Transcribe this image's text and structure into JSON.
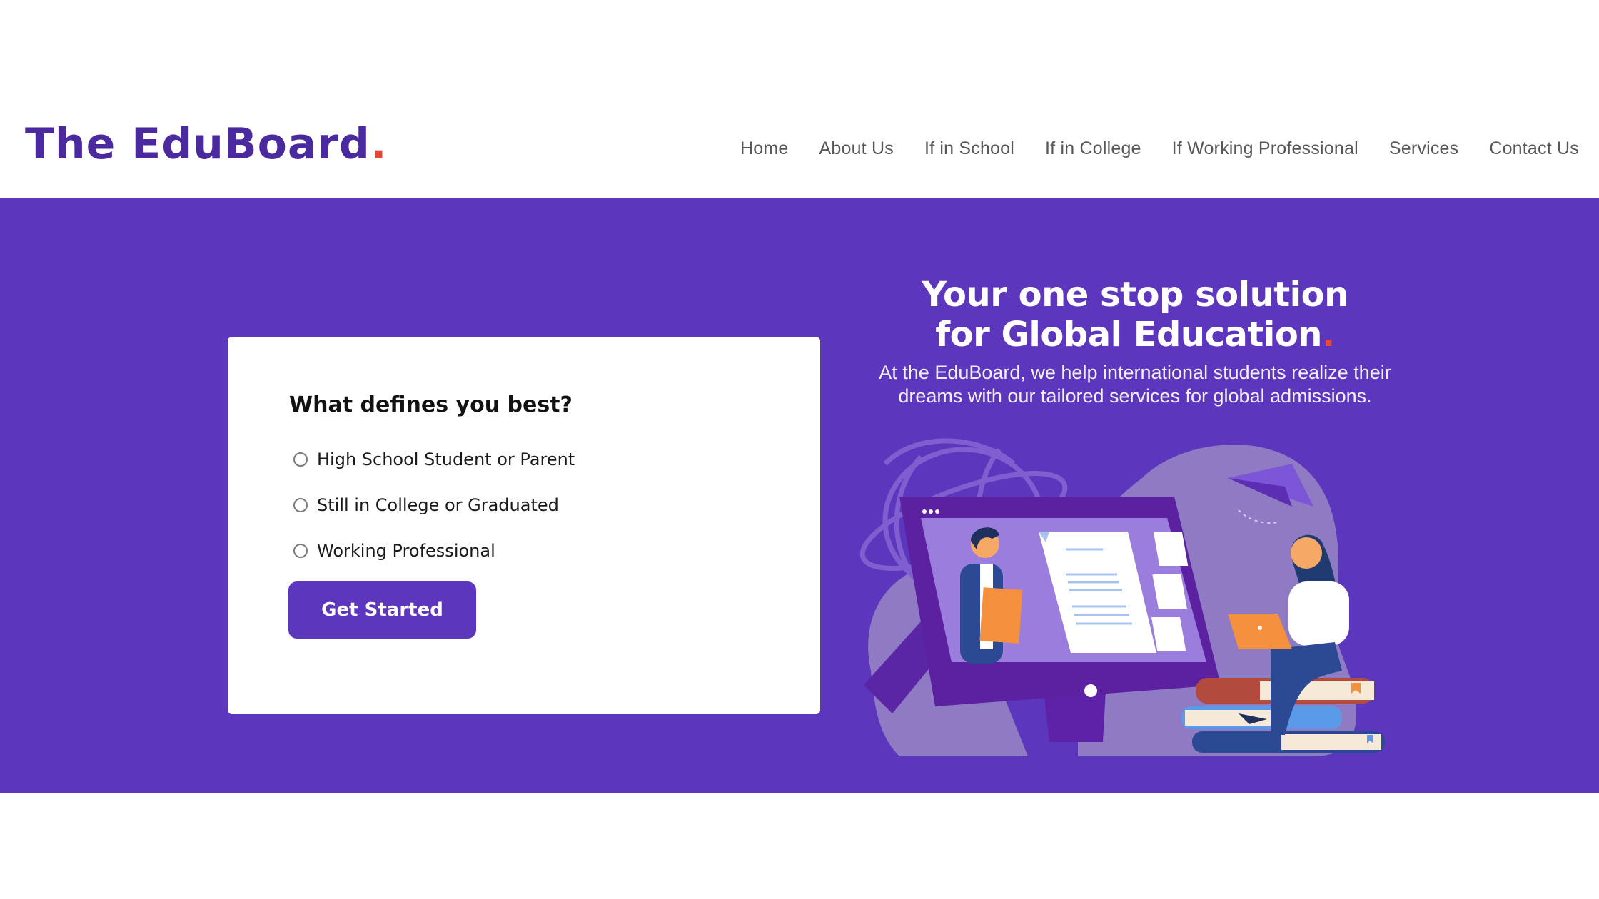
{
  "brand": {
    "name": "The EduBoard",
    "dot": ".",
    "primary_color": "#5c36bc",
    "logo_color": "#4b2a9f",
    "accent_color": "#e8473c"
  },
  "nav": {
    "items": [
      {
        "label": "Home"
      },
      {
        "label": "About Us"
      },
      {
        "label": "If in School"
      },
      {
        "label": "If in College"
      },
      {
        "label": "If Working Professional"
      },
      {
        "label": "Services"
      },
      {
        "label": "Contact Us"
      }
    ]
  },
  "form": {
    "question": "What defines you best?",
    "options": [
      {
        "label": "High School Student or Parent",
        "selected": false
      },
      {
        "label": "Still in College or Graduated",
        "selected": false
      },
      {
        "label": "Working Professional",
        "selected": false
      }
    ],
    "submit_label": "Get Started"
  },
  "hero": {
    "headline_line1": "Your one stop solution",
    "headline_line2": "for Global Education",
    "headline_dot": ".",
    "subtext_line1": "At the EduBoard, we help international students realize their",
    "subtext_line2": "dreams with our tailored services for global admissions.",
    "illustration": "online-education-illustration"
  }
}
